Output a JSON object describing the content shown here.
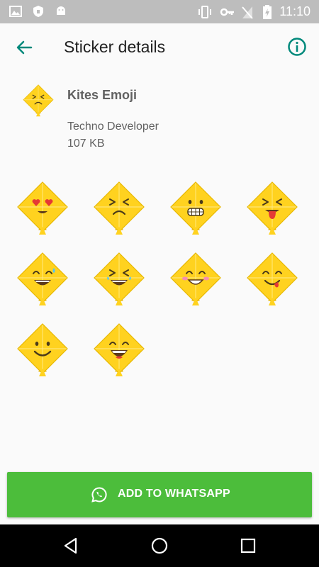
{
  "status_bar": {
    "time": "11:10",
    "icons": [
      "image-icon",
      "shield-icon",
      "android-icon",
      "vibrate-icon",
      "key-icon",
      "no-signal-icon",
      "battery-charging-icon"
    ]
  },
  "app_bar": {
    "title": "Sticker details",
    "back_icon": "arrow-back-icon",
    "info_icon": "info-icon"
  },
  "pack": {
    "name": "Kites Emoji",
    "publisher": "Techno Developer",
    "size": "107 KB"
  },
  "stickers": [
    {
      "face": "heart-eyes"
    },
    {
      "face": "frown"
    },
    {
      "face": "grimace"
    },
    {
      "face": "tongue"
    },
    {
      "face": "sweat-smile"
    },
    {
      "face": "tears-of-joy"
    },
    {
      "face": "blush-smile"
    },
    {
      "face": "tongue-smile"
    },
    {
      "face": "smile"
    },
    {
      "face": "laugh"
    }
  ],
  "add_button": {
    "label": "ADD TO WHATSAPP",
    "icon": "whatsapp-icon"
  },
  "nav_bar": {
    "icons": [
      "back-triangle-icon",
      "home-circle-icon",
      "recents-square-icon"
    ]
  },
  "colors": {
    "accent": "#00897b",
    "button": "#4cbd3b",
    "kite": "#ffd21f"
  }
}
